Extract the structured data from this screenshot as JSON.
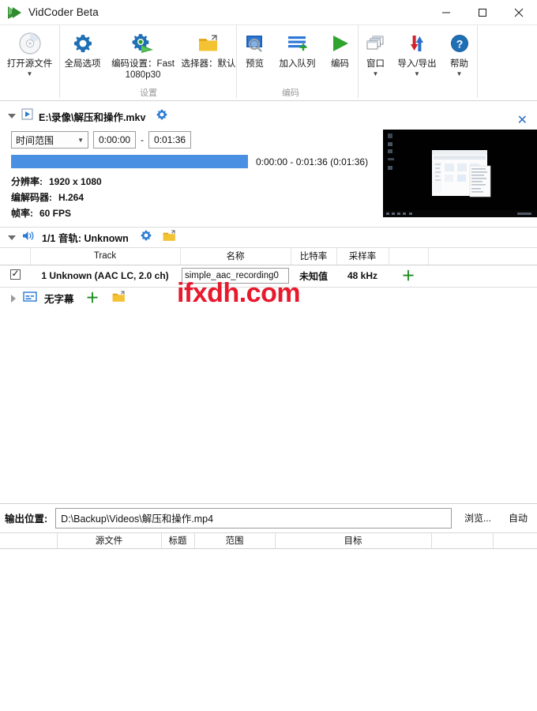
{
  "window": {
    "title": "VidCoder Beta",
    "logo_icon": "vidcoder-play-logo",
    "minimize_label": "—",
    "maximize_label": "☐",
    "close_label": "✕"
  },
  "ribbon": {
    "groups": [
      {
        "label": "",
        "buttons": [
          {
            "id": "open-source",
            "label": "打开源文件",
            "icon": "disc-icon",
            "has_caret": true
          }
        ]
      },
      {
        "label": "设置",
        "buttons": [
          {
            "id": "global-options",
            "label": "全局选项",
            "icon": "gear-icon",
            "has_caret": false
          },
          {
            "id": "encoding-settings",
            "label": "编码设置：Fast 1080p30",
            "icon": "gear-play-icon",
            "has_caret": true
          },
          {
            "id": "picker",
            "label": "选择器：默认",
            "icon": "folder-out-icon",
            "has_caret": true
          }
        ]
      },
      {
        "label": "编码",
        "buttons": [
          {
            "id": "preview",
            "label": "预览",
            "icon": "preview-search-icon",
            "has_caret": false
          },
          {
            "id": "add-to-queue",
            "label": "加入队列",
            "icon": "queue-add-icon",
            "has_caret": false
          },
          {
            "id": "encode",
            "label": "编码",
            "icon": "play-green-icon",
            "has_caret": false
          }
        ]
      },
      {
        "label": "",
        "buttons": [
          {
            "id": "window",
            "label": "窗口",
            "icon": "windows-stack-icon",
            "has_caret": true
          },
          {
            "id": "import-export",
            "label": "导入/导出",
            "icon": "import-export-arrows-icon",
            "has_caret": true
          },
          {
            "id": "help",
            "label": "帮助",
            "icon": "help-question-icon",
            "has_caret": true
          }
        ]
      }
    ]
  },
  "source": {
    "expander_icon": "triangle-down-icon",
    "file_icon": "video-file-icon",
    "path": "E:\\录像\\解压和操作.mkv",
    "settings_icon": "gear-icon",
    "close_icon": "close-icon",
    "range_mode": "时间范围",
    "range_start": "0:00:00",
    "range_separator": "-",
    "range_end": "0:01:36",
    "progress_percent": 100,
    "range_summary": "0:00:00 - 0:01:36   (0:01:36)",
    "meta": [
      {
        "key": "分辨率:",
        "value": "1920 x 1080"
      },
      {
        "key": "编解码器:",
        "value": "H.264"
      },
      {
        "key": "帧率:",
        "value": "60 FPS"
      }
    ]
  },
  "audio": {
    "expander_icon": "triangle-down-icon",
    "speaker_icon": "speaker-icon",
    "title": "1/1 音轨: Unknown",
    "settings_icon": "gear-icon",
    "folder_icon": "folder-out-icon",
    "columns": [
      "",
      "Track",
      "名称",
      "比特率",
      "采样率",
      "",
      ""
    ],
    "rows": [
      {
        "checked": true,
        "track": "1 Unknown (AAC LC, 2.0 ch)",
        "name": "simple_aac_recording0",
        "bitrate": "未知值",
        "samplerate": "48 kHz",
        "add_icon": "plus-icon"
      }
    ]
  },
  "subtitles": {
    "expander_icon": "triangle-right-icon",
    "icon": "subtitle-icon",
    "title": "无字幕",
    "add_icon": "plus-icon",
    "folder_icon": "folder-out-icon"
  },
  "watermark": {
    "text": "ifxdh.com",
    "color": "#e8192c"
  },
  "output": {
    "label": "输出位置:",
    "path": "D:\\Backup\\Videos\\解压和操作.mp4",
    "browse_label": "浏览...",
    "auto_label": "自动"
  },
  "queue": {
    "columns": [
      "",
      "源文件",
      "标题",
      "范围",
      "目标",
      "",
      ""
    ]
  },
  "colors": {
    "accent_blue": "#4a90e2",
    "link_blue": "#2a6fc9",
    "green": "#1a8a1a",
    "watermark_red": "#e8192c"
  }
}
